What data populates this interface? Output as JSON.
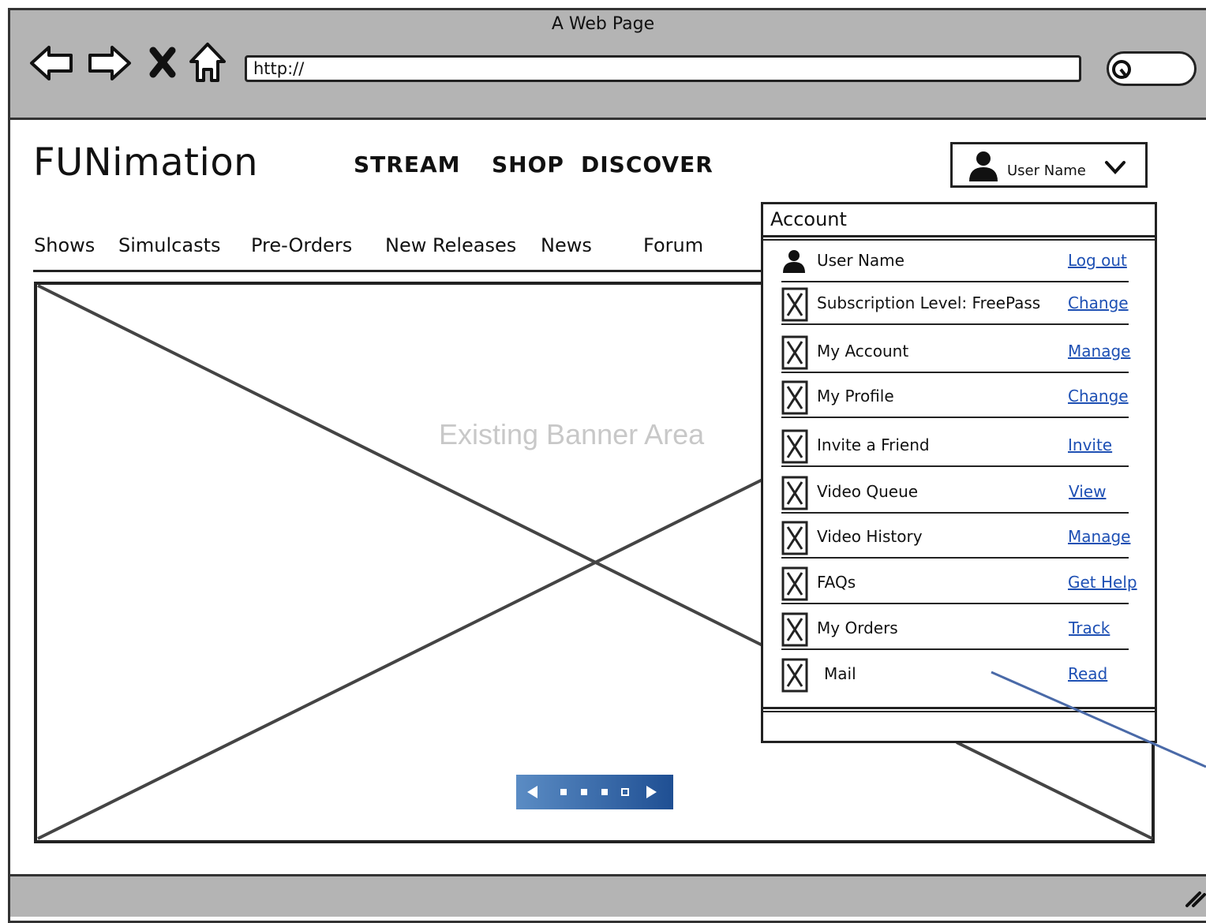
{
  "window": {
    "title": "A Web Page",
    "url": "http://"
  },
  "site": {
    "logo": "FUNimation",
    "top_nav": [
      "STREAM",
      "SHOP",
      "DISCOVER"
    ],
    "sub_nav": [
      "Shows",
      "Simulcasts",
      "Pre-Orders",
      "New Releases",
      "News",
      "Forum"
    ]
  },
  "user_menu": {
    "label": "User Name"
  },
  "banner": {
    "text": "Existing Banner Area",
    "carousel_pages": 4,
    "carousel_active_index": 3
  },
  "account": {
    "title": "Account",
    "items": [
      {
        "label": "User Name",
        "action": "Log out",
        "icon": "user-icon"
      },
      {
        "label": "Subscription Level: FreePass",
        "action": "Change",
        "icon": "image-placeholder-icon"
      },
      {
        "label": "My Account",
        "action": "Manage",
        "icon": "image-placeholder-icon"
      },
      {
        "label": "My Profile",
        "action": "Change",
        "icon": "image-placeholder-icon"
      },
      {
        "label": "Invite a Friend",
        "action": "Invite",
        "icon": "image-placeholder-icon"
      },
      {
        "label": "Video Queue",
        "action": "View",
        "icon": "image-placeholder-icon"
      },
      {
        "label": "Video History",
        "action": "Manage",
        "icon": "image-placeholder-icon"
      },
      {
        "label": "FAQs",
        "action": "Get Help",
        "icon": "image-placeholder-icon"
      },
      {
        "label": "My Orders",
        "action": "Track",
        "icon": "image-placeholder-icon"
      },
      {
        "label": "Mail",
        "action": "Read",
        "icon": "image-placeholder-icon"
      }
    ]
  },
  "colors": {
    "chrome": "#b4b4b4",
    "link": "#1e50b4",
    "carousel": "#2a5aa0",
    "annotation": "#4a6aa8"
  }
}
